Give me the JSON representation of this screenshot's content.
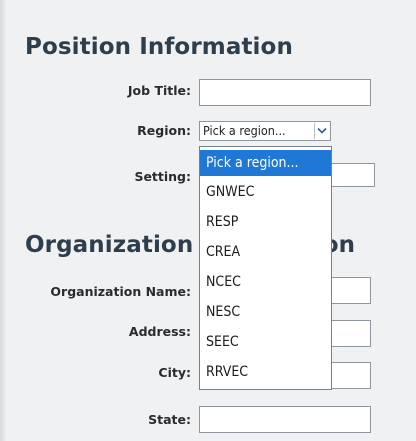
{
  "position_section": {
    "title": "Position Information",
    "job_title_label": "Job Title:",
    "job_title_value": "",
    "region_label": "Region:",
    "region_selected": "Pick a region...",
    "setting_label": "Setting:"
  },
  "region_dropdown": {
    "options": [
      "Pick a region...",
      "GNWEC",
      "RESP",
      "CREA",
      "NCEC",
      "NESC",
      "SEEC",
      "RRVEC"
    ],
    "highlighted_index": 0
  },
  "organization_section": {
    "title": "Organization Information",
    "name_label": "Organization Name:",
    "address_label": "Address:",
    "city_label": "City:",
    "state_label": "State:"
  },
  "colors": {
    "heading": "#2e3e4c",
    "selection_highlight": "#1f78d6",
    "page_background": "#f0f1f3"
  },
  "icons": {
    "select_arrow": "chevron-down-icon"
  }
}
